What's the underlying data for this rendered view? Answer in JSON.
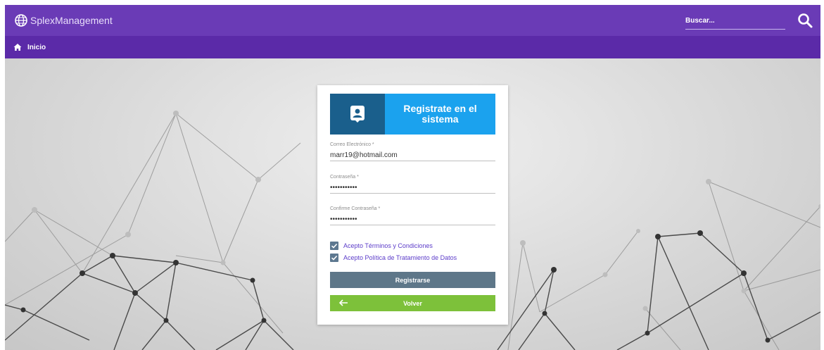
{
  "header": {
    "brand": "SplexManagement",
    "search_placeholder": "Buscar..."
  },
  "breadcrumb": {
    "home_label": "Inicio"
  },
  "form": {
    "title": "Registrate en el sistema",
    "email_label": "Correo Electrónico *",
    "email_value": "marr19@hotmail.com",
    "password_label": "Contraseña *",
    "password_value": "•••••••••••",
    "confirm_label": "Confirme Contraseña *",
    "confirm_value": "•••••••••••",
    "terms_label": "Acepto Términos y Condiciones",
    "privacy_label": "Acepto Política de Tratamiento de Datos",
    "register_label": "Registrarse",
    "back_label": "Volver"
  },
  "colors": {
    "topbar": "#6a3bb6",
    "subbar": "#5b2aa8",
    "card_header_dark": "#1a5f8c",
    "card_header_light": "#1ba2ee",
    "register_button": "#5e7789",
    "back_button": "#7dc13a"
  },
  "icons": {
    "brand": "globe-icon",
    "search": "search-icon",
    "home": "home-icon",
    "register": "user-badge-icon",
    "check": "check-icon",
    "back": "arrow-left-icon"
  }
}
